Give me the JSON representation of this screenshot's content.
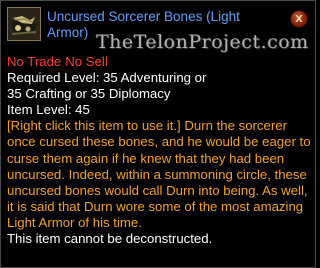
{
  "item": {
    "icon": "sorcerer-bones-icon",
    "name": "Uncursed Sorcerer Bones (Light Armor)",
    "close_glyph": "X",
    "watermark": "TheTelonProject.com"
  },
  "flags": {
    "no_trade": "No Trade",
    "no_sell": "No Sell"
  },
  "requirements": {
    "line1": "Required Level: 35 Adventuring or",
    "line2": "35 Crafting or 35 Diplomacy",
    "item_level": "Item Level: 45"
  },
  "description": "[Right click this item to use it.] Durn the sorcerer once cursed these bones, and he would be eager to curse them again if he knew that they had been uncursed. Indeed, within a summoning circle, these uncursed bones would call Durn into being. As well, it is said that Durn wore some of the most amazing Light Armor of his time.",
  "footer": "This item cannot be deconstructed.",
  "colors": {
    "title": "#5aa0ff",
    "flag": "#ff3a2a",
    "desc": "#f7a21a",
    "text": "#ffffff"
  }
}
